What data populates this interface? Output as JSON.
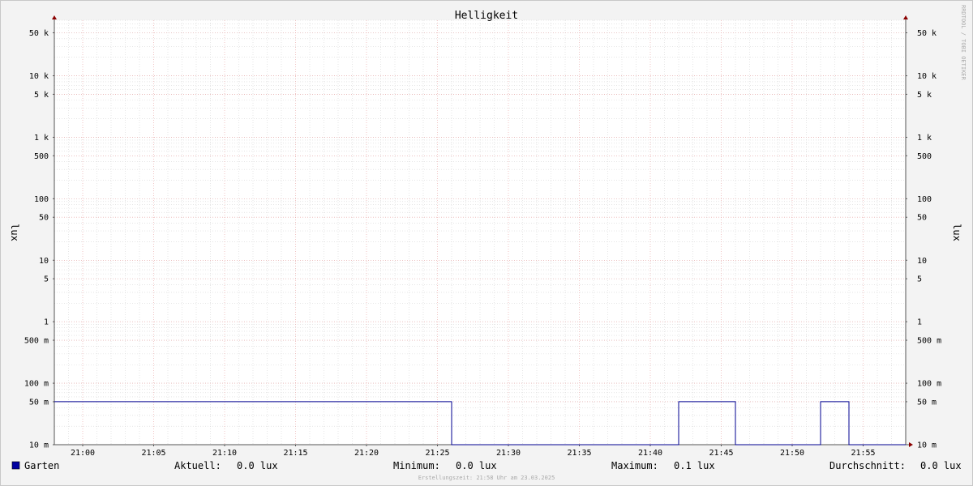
{
  "chart_data": {
    "type": "line",
    "title": "Helligkeit",
    "ylabel": "lux",
    "yscale": "log",
    "ylim": [
      0.01,
      80000
    ],
    "xlim": [
      "20:58",
      "21:58"
    ],
    "ytick_values": [
      0.01,
      0.05,
      0.1,
      0.5,
      1,
      5,
      10,
      50,
      100,
      500,
      1000,
      5000,
      10000,
      50000
    ],
    "ytick_labels": [
      "10 m",
      "50 m",
      "100 m",
      "500 m",
      "1",
      "5",
      "10",
      "50",
      "100",
      "500",
      "1 k",
      "5 k",
      "10 k",
      "50 k"
    ],
    "xtick_labels": [
      "21:00",
      "21:05",
      "21:10",
      "21:15",
      "21:20",
      "21:25",
      "21:30",
      "21:35",
      "21:40",
      "21:45",
      "21:50",
      "21:55"
    ],
    "series": [
      {
        "name": "Garten",
        "color": "#000090",
        "points": [
          [
            "20:58",
            0.05
          ],
          [
            "21:26",
            0.05
          ],
          [
            "21:26",
            0.01
          ],
          [
            "21:42",
            0.01
          ],
          [
            "21:42",
            0.05
          ],
          [
            "21:46",
            0.05
          ],
          [
            "21:46",
            0.01
          ],
          [
            "21:52",
            0.01
          ],
          [
            "21:52",
            0.05
          ],
          [
            "21:54",
            0.05
          ],
          [
            "21:54",
            0.01
          ],
          [
            "21:58",
            0.01
          ]
        ]
      }
    ],
    "grid": true,
    "legend": "bottom"
  },
  "legend": {
    "series_name": "Garten",
    "swatch_color": "#0000a0",
    "aktuell_label": "Aktuell:",
    "aktuell_value": "0.0 lux",
    "minimum_label": "Minimum:",
    "minimum_value": "0.0 lux",
    "maximum_label": "Maximum:",
    "maximum_value": "0.1 lux",
    "durchschnitt_label": "Durchschnitt:",
    "durchschnitt_value": "0.0 lux"
  },
  "footer": "Erstellungszeit: 21:58 Uhr am 23.03.2025",
  "watermark": "RRDTOOL / TOBI OETIKER"
}
